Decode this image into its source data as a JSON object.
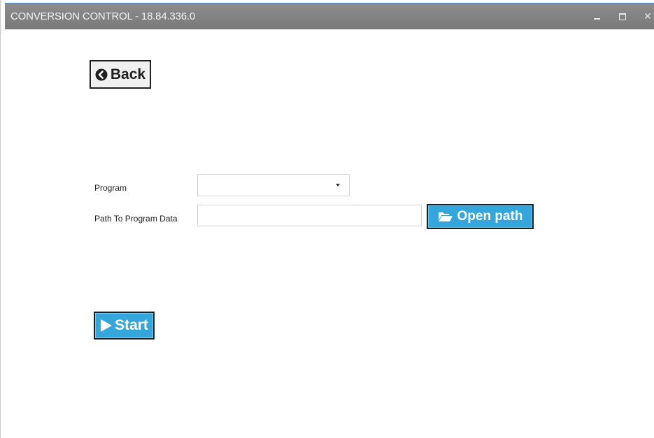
{
  "window": {
    "title": "CONVERSION CONTROL - 18.84.336.0",
    "controls": {
      "minimize_icon": "minimize-icon",
      "maximize_icon": "maximize-icon",
      "close_icon": "close-icon",
      "close_glyph": "✕"
    }
  },
  "back_button": {
    "label": "Back",
    "icon": "back-circle-icon"
  },
  "form": {
    "program": {
      "label": "Program",
      "selected_value": "",
      "icon": "chevron-down-icon"
    },
    "path": {
      "label": "Path To Program Data",
      "value": "",
      "placeholder": ""
    },
    "open_path_button": {
      "label": "Open path",
      "icon": "folder-open-icon"
    }
  },
  "start_button": {
    "label": "Start",
    "icon": "play-icon"
  },
  "colors": {
    "titlebar": "#858585",
    "accent_button": "#35a6dc",
    "button_border": "#1e1e1e"
  }
}
